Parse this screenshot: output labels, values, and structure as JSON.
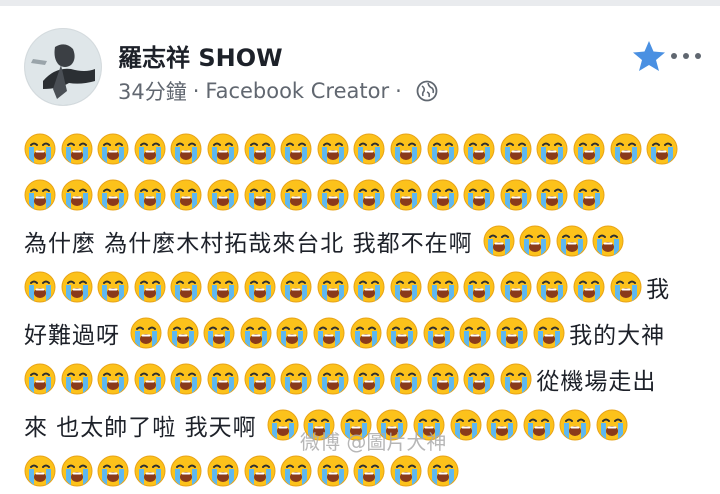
{
  "post": {
    "author": "羅志祥 SHOW",
    "time": "34分鐘",
    "separator": "·",
    "source": "Facebook Creator",
    "accent_color": "#4a90e2",
    "icons": {
      "favorite": "star-icon",
      "more": "more-options-icon",
      "privacy": "globe-icon",
      "emoji": "loudly-crying-face-emoji"
    }
  },
  "message": {
    "lines": [
      {
        "pre_emoji": 18,
        "text": "",
        "post_emoji": 0
      },
      {
        "pre_emoji": 16,
        "text": "",
        "post_emoji": 0
      },
      {
        "pre_emoji": 0,
        "text": "為什麼 為什麼木村拓哉來台北 我都不在啊",
        "post_emoji": 4
      },
      {
        "pre_emoji": 17,
        "text": "我",
        "post_emoji": 0
      },
      {
        "pre_emoji": 0,
        "text": "好難過呀",
        "post_emoji": 12,
        "suffix": "我的大神"
      },
      {
        "pre_emoji": 14,
        "text": "從機場走出",
        "post_emoji": 0
      },
      {
        "pre_emoji": 0,
        "text": "來 也太帥了啦 我天啊",
        "post_emoji": 10
      },
      {
        "pre_emoji": 12,
        "text": "",
        "post_emoji": 0
      }
    ]
  },
  "watermark": "微博 @圖片大神"
}
